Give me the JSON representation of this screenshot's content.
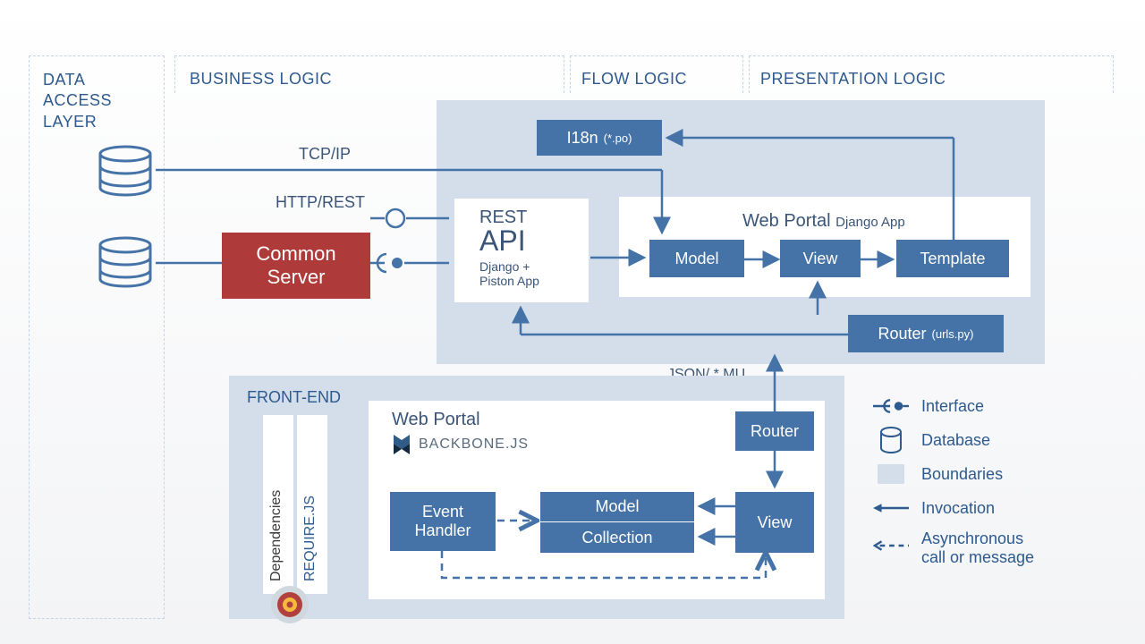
{
  "layers": {
    "data_access": "DATA ACCESS LAYER",
    "business_logic": "BUSINESS LOGIC",
    "flow_logic": "FLOW LOGIC",
    "presentation_logic": "PRESENTATION LOGIC"
  },
  "tcp_ip": "TCP/IP",
  "http_rest": "HTTP/REST",
  "common_server": {
    "line1": "Common",
    "line2": "Server"
  },
  "rest_api": {
    "line1": "REST",
    "line2": "API",
    "line3": "Django +",
    "line4": "Piston App"
  },
  "i18n": {
    "label": "I18n",
    "sub": "(*.po)"
  },
  "web_portal_django": {
    "label": "Web Portal",
    "sub": "Django App"
  },
  "model": "Model",
  "view": "View",
  "template": "Template",
  "router_urls": {
    "label": "Router",
    "sub": "(urls.py)"
  },
  "json_mu": "JSON/ *.MU",
  "front_end": "FRONT-END",
  "dependencies": "Dependencies",
  "requirejs": "REQUIRE.JS",
  "web_portal_bb": "Web Portal",
  "backbone_js": "BACKBONE.JS",
  "fe_router": "Router",
  "fe_event_handler": {
    "line1": "Event",
    "line2": "Handler"
  },
  "fe_model": "Model",
  "fe_collection": "Collection",
  "fe_view": "View",
  "legend": {
    "interface": "Interface",
    "database": "Database",
    "boundaries": "Boundaries",
    "invocation": "Invocation",
    "async": {
      "line1": "Asynchronous",
      "line2": "call or message"
    }
  }
}
